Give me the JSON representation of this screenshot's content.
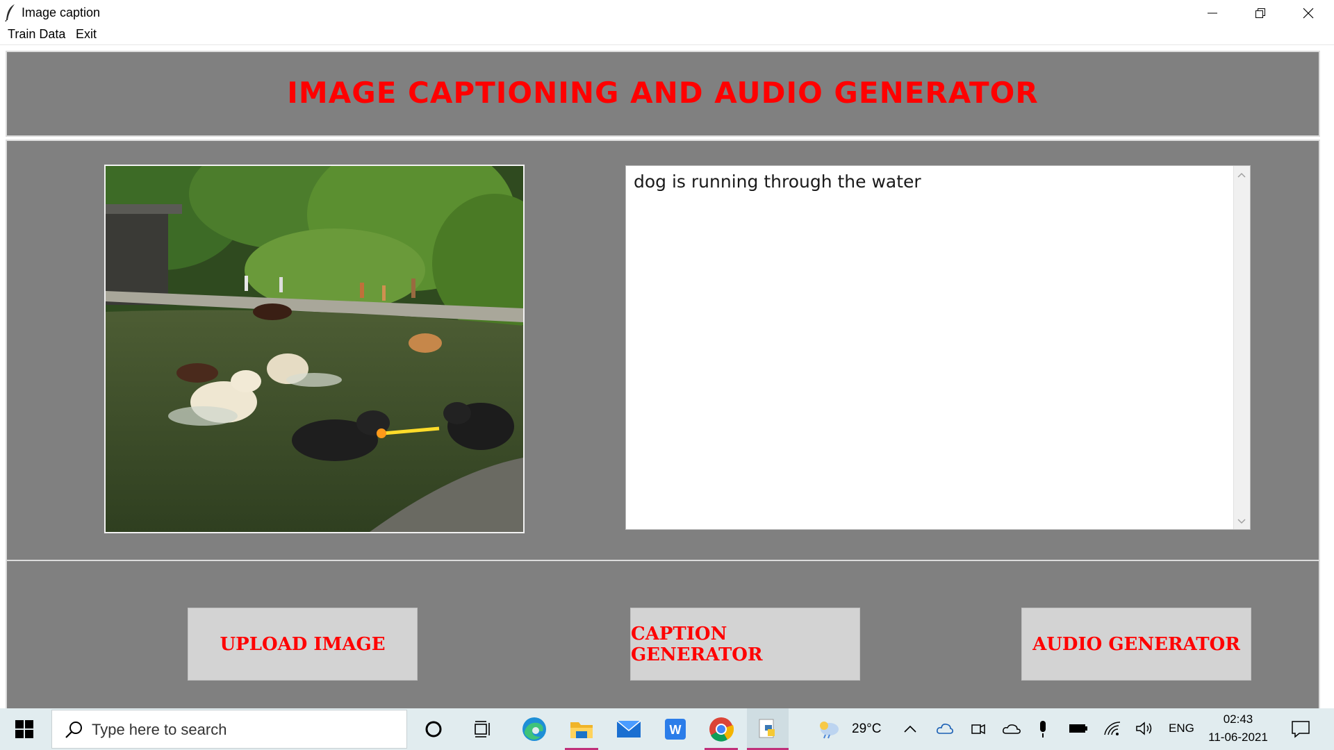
{
  "window": {
    "title": "Image caption"
  },
  "menu": {
    "train_data": "Train Data",
    "exit": "Exit"
  },
  "header": {
    "title": "IMAGE CAPTIONING AND AUDIO GENERATOR"
  },
  "caption": {
    "text": "dog is running through the water"
  },
  "buttons": {
    "upload": "UPLOAD IMAGE",
    "caption": "CAPTION GENERATOR",
    "audio": "AUDIO GENERATOR"
  },
  "taskbar": {
    "search_placeholder": "Type here to search",
    "weather": "29°C",
    "language": "ENG",
    "time": "02:43",
    "date": "11-06-2021",
    "pinned_icons": [
      "cortana-icon",
      "task-view-icon",
      "edge-icon",
      "file-explorer-icon",
      "mail-icon",
      "word-icon",
      "chrome-icon",
      "python-icon"
    ]
  },
  "colors": {
    "panel_bg": "#808080",
    "heading_red": "#ff0000",
    "button_bg": "#d3d3d3",
    "taskbar_bg": "#e1ecef"
  }
}
